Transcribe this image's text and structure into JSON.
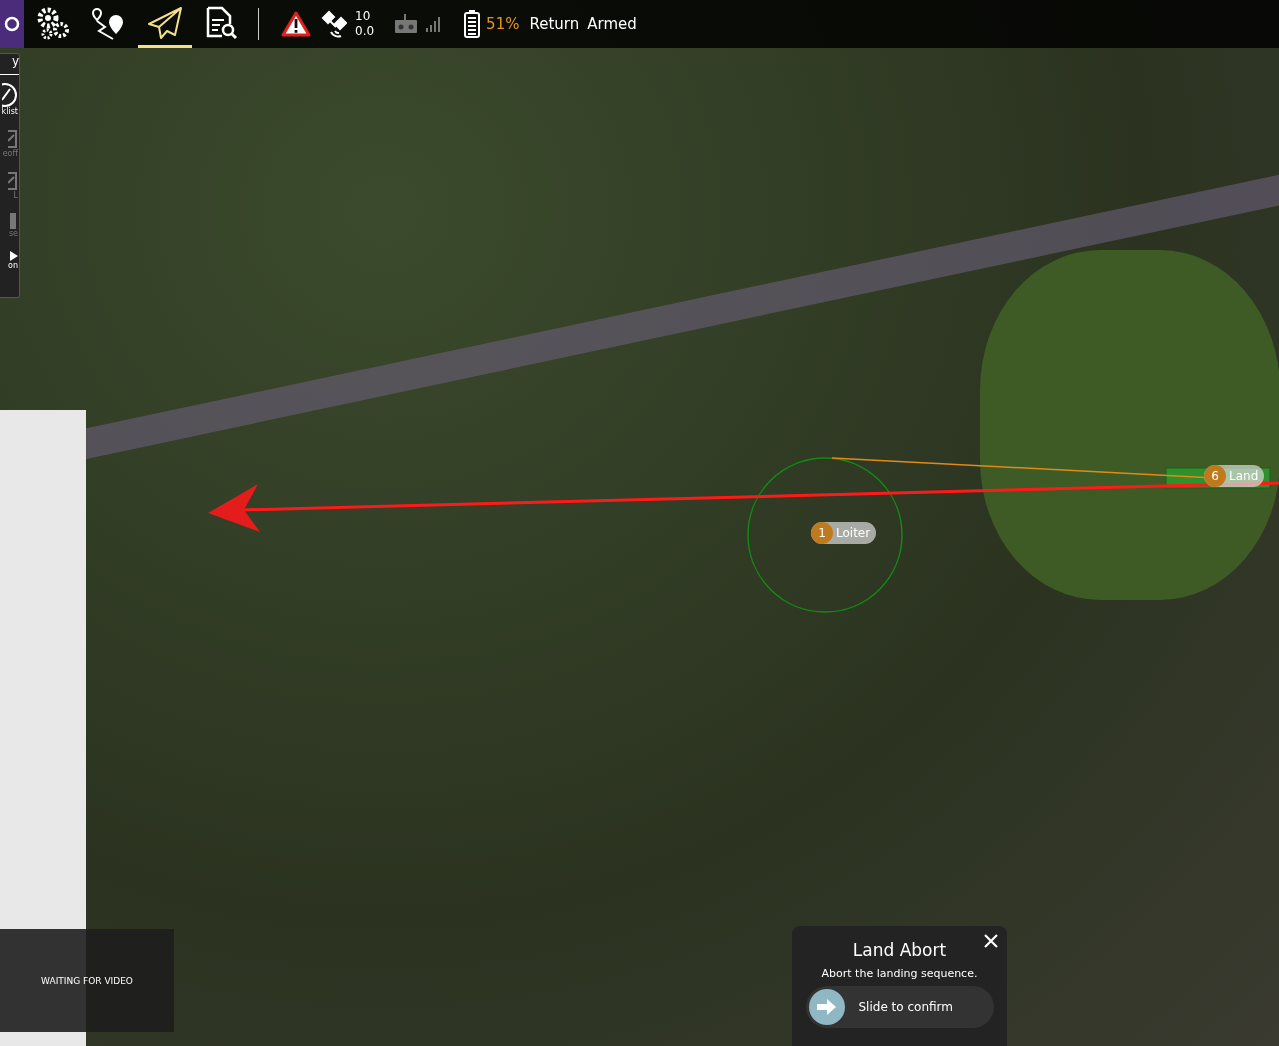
{
  "toolbar": {
    "views": [
      {
        "kind": "settings",
        "selected": false
      },
      {
        "kind": "plan",
        "selected": false
      },
      {
        "kind": "fly",
        "selected": true
      },
      {
        "kind": "analyze",
        "selected": false
      }
    ],
    "gps": {
      "count": "10",
      "hdop": "0.0"
    },
    "battery": "51%",
    "flight_mode": "Return",
    "arm_state": "Armed"
  },
  "fly_tools": {
    "header": "y",
    "items": [
      {
        "kind": "checklist",
        "label": "klist",
        "disabled": false
      },
      {
        "kind": "takeoff",
        "label": "eoff",
        "disabled": true
      },
      {
        "kind": "rtl",
        "label": "L",
        "disabled": true
      },
      {
        "kind": "pause",
        "label": "se",
        "disabled": true
      },
      {
        "kind": "action",
        "label": "on",
        "disabled": false
      }
    ]
  },
  "mission": {
    "items": [
      {
        "kind": "loiter",
        "number": "1",
        "label": "Loiter"
      },
      {
        "kind": "land",
        "number": "6",
        "label": "Land"
      }
    ]
  },
  "video": {
    "message": "WAITING FOR VIDEO"
  },
  "confirm_dialog": {
    "title": "Land Abort",
    "message": "Abort the landing sequence.",
    "slider": {
      "label": "Slide to confirm",
      "level": 0
    }
  }
}
